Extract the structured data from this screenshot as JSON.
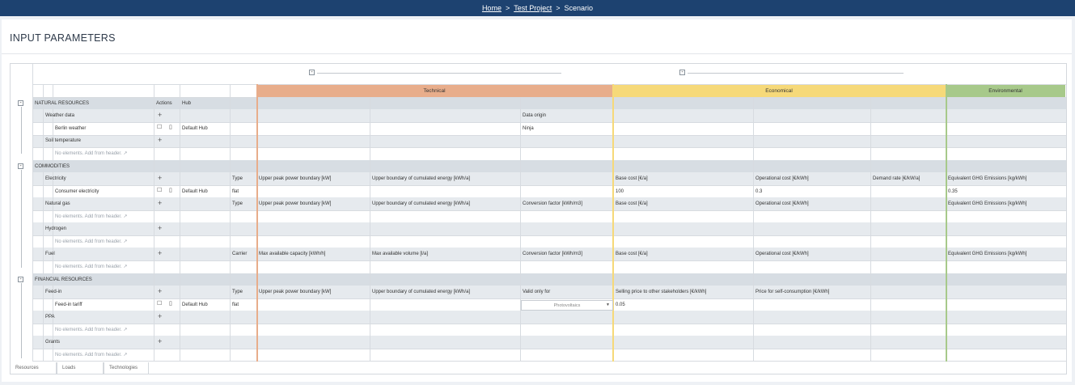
{
  "breadcrumb": {
    "home": "Home",
    "project": "Test Project",
    "current": "Scenario",
    "separator": ">"
  },
  "page_title": "INPUT PARAMETERS",
  "collapse_symbol": "-",
  "groups": {
    "technical": "Technical",
    "economical": "Economical",
    "environmental": "Environmental"
  },
  "group_colors": {
    "technical": "#e8ad8b",
    "economical": "#f6d979",
    "environmental": "#a7c98a"
  },
  "sections": {
    "natural": {
      "label": "NATURAL RESOURCES",
      "actions": "Actions",
      "hub": "Hub"
    },
    "commodities": {
      "label": "COMMODITIES"
    },
    "financial": {
      "label": "FINANCIAL RESOURCES"
    }
  },
  "add_symbol": "+",
  "empty_hint": "No elements. Add from header. ↗",
  "weather": {
    "label": "Weather data",
    "data_origin": "Data origin",
    "item": "Berlin weather",
    "hub": "Default Hub",
    "origin_value": "Ninja"
  },
  "soil": {
    "label": "Soil temperature"
  },
  "electricity": {
    "label": "Electricity",
    "type": "Type",
    "c1": "Upper peak power boundary [kW]",
    "c2": "Upper boundary of cumulated energy [kWh/a]",
    "c3": "Base cost [€/a]",
    "c4": "Operational cost [€/kWh]",
    "c5": "Demand rate [€/kW/a]",
    "c6": "Equivalent GHG Emissions [kg/kWh]",
    "item": "Consumer electricity",
    "hub": "Default Hub",
    "type_value": "flat",
    "v_base": "100",
    "v_op": "0.3",
    "v_ghg": "0.35"
  },
  "gas": {
    "label": "Natural gas",
    "type": "Type",
    "c1": "Upper peak power boundary [kW]",
    "c2": "Upper boundary of cumulated energy [kWh/a]",
    "c3": "Conversion factor [kWh/m3]",
    "c4": "Base cost [€/a]",
    "c5": "Operational cost [€/kWh]",
    "c6": "Equivalent GHG Emissions [kg/kWh]"
  },
  "hydrogen": {
    "label": "Hydrogen"
  },
  "fuel": {
    "label": "Fuel",
    "carrier": "Carrier",
    "c1": "Max available capacity [kWh/h]",
    "c2": "Max available volume [l/a]",
    "c3": "Conversion factor [kWh/m3]",
    "c4": "Base cost [€/a]",
    "c5": "Operational cost [€/kWh]",
    "c6": "Equivalent GHG Emissions [kg/kWh]"
  },
  "feedin": {
    "label": "Feed-in",
    "type": "Type",
    "c1": "Upper peak power boundary [kW]",
    "c2": "Upper boundary of cumulated energy [kWh/a]",
    "c3": "Valid only for",
    "c4": "Selling price to other stakeholders [€/kWh]",
    "c5": "Price for self-consumption [€/kWh]",
    "item": "Feed-in tariff",
    "hub": "Default Hub",
    "type_value": "flat",
    "select_value": "Photovoltaics",
    "v_price": "0.05"
  },
  "ppa": {
    "label": "PPA"
  },
  "grants": {
    "label": "Grants"
  },
  "tabs": [
    "Resources",
    "Loads",
    "Technologies"
  ]
}
